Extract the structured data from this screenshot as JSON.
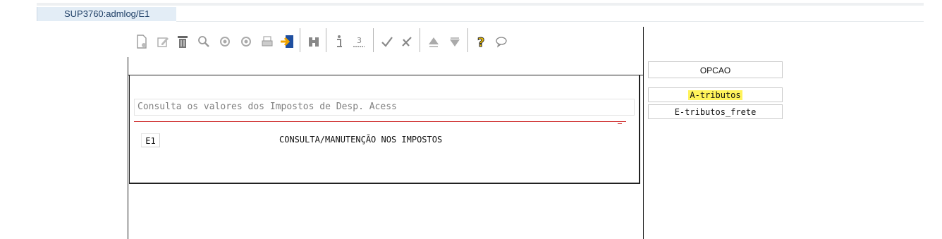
{
  "tab": {
    "label": "SUP3760:admlog/E1"
  },
  "toolbar": {
    "buttons": [
      {
        "name": "new-icon",
        "glyph": "▫"
      },
      {
        "name": "edit-icon",
        "glyph": "✎"
      },
      {
        "name": "trash-icon",
        "glyph": "🗑"
      },
      {
        "name": "search-icon",
        "glyph": "⚲"
      },
      {
        "name": "prev-icon",
        "glyph": "◉"
      },
      {
        "name": "next-icon",
        "glyph": "◉"
      },
      {
        "name": "print-icon",
        "glyph": "⎙"
      },
      {
        "name": "exit-icon",
        "glyph": "⇥"
      },
      {
        "name": "binoculars-icon",
        "glyph": "⚶"
      },
      {
        "name": "info-icon",
        "glyph": "i"
      },
      {
        "name": "number-icon",
        "glyph": "3"
      },
      {
        "name": "confirm-icon",
        "glyph": "✓"
      },
      {
        "name": "cancel-icon",
        "glyph": "✗"
      },
      {
        "name": "up-icon",
        "glyph": "▲"
      },
      {
        "name": "down-icon",
        "glyph": "▼"
      },
      {
        "name": "help-icon",
        "glyph": "?"
      },
      {
        "name": "comment-icon",
        "glyph": "○"
      }
    ]
  },
  "main": {
    "description": "Consulta os valores dos Impostos de Desp. Acess",
    "code": "E1",
    "title": "CONSULTA/MANUTENÇÃO NOS IMPOSTOS"
  },
  "options": {
    "header": "OPCAO",
    "items": [
      "A-tributos",
      "E-tributos_frete"
    ]
  },
  "colors": {
    "highlight": "#fff35a",
    "accent_line": "#cc1f1f"
  }
}
